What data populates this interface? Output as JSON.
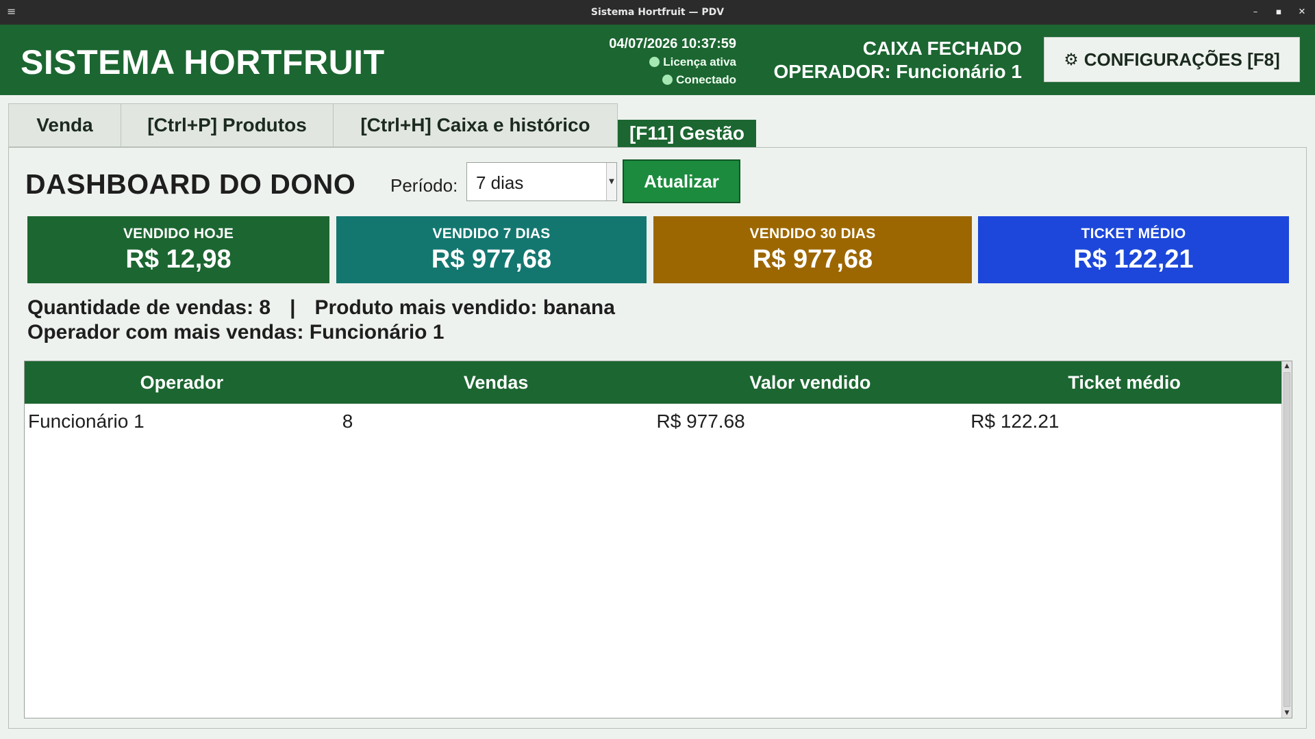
{
  "window": {
    "title": "Sistema Hortfruit — PDV",
    "menu_icon": "≡",
    "minimize": "–",
    "maximize": "▪",
    "close": "✕"
  },
  "header": {
    "app_title": "SISTEMA HORTFRUIT",
    "datetime": "04/07/2026 10:37:59",
    "license_status": "Licença ativa",
    "connection_status": "Conectado",
    "cash_status": "CAIXA FECHADO",
    "operator": "OPERADOR: Funcionário 1",
    "config_icon": "⚙",
    "config_label": "CONFIGURAÇÕES  [F8]",
    "accent_color": "#1c6631"
  },
  "tabs": [
    {
      "label": "Venda"
    },
    {
      "label": "[Ctrl+P] Produtos"
    },
    {
      "label": "[Ctrl+H] Caixa e histórico"
    },
    {
      "label": "[F11] Gestão",
      "active": true
    }
  ],
  "dashboard": {
    "title": "DASHBOARD DO DONO",
    "period_label": "Período:",
    "period_value": "7 dias",
    "update_button": "Atualizar",
    "cards": [
      {
        "label": "VENDIDO HOJE",
        "value": "R$ 12,98",
        "color": "#1c6631"
      },
      {
        "label": "VENDIDO 7 DIAS",
        "value": "R$ 977,68",
        "color": "#137770"
      },
      {
        "label": "VENDIDO 30 DIAS",
        "value": "R$ 977,68",
        "color": "#9c6700"
      },
      {
        "label": "TICKET MÉDIO",
        "value": "R$ 122,21",
        "color": "#1c47da"
      }
    ],
    "sales_count": "Quantidade de vendas: 8",
    "separator": "|",
    "top_product": "Produto mais vendido: banana",
    "top_operator": "Operador com mais vendas: Funcionário 1"
  },
  "table": {
    "columns": [
      "Operador",
      "Vendas",
      "Valor vendido",
      "Ticket médio"
    ],
    "rows": [
      [
        "Funcionário 1",
        "8",
        "R$ 977.68",
        "R$ 122.21"
      ]
    ]
  }
}
